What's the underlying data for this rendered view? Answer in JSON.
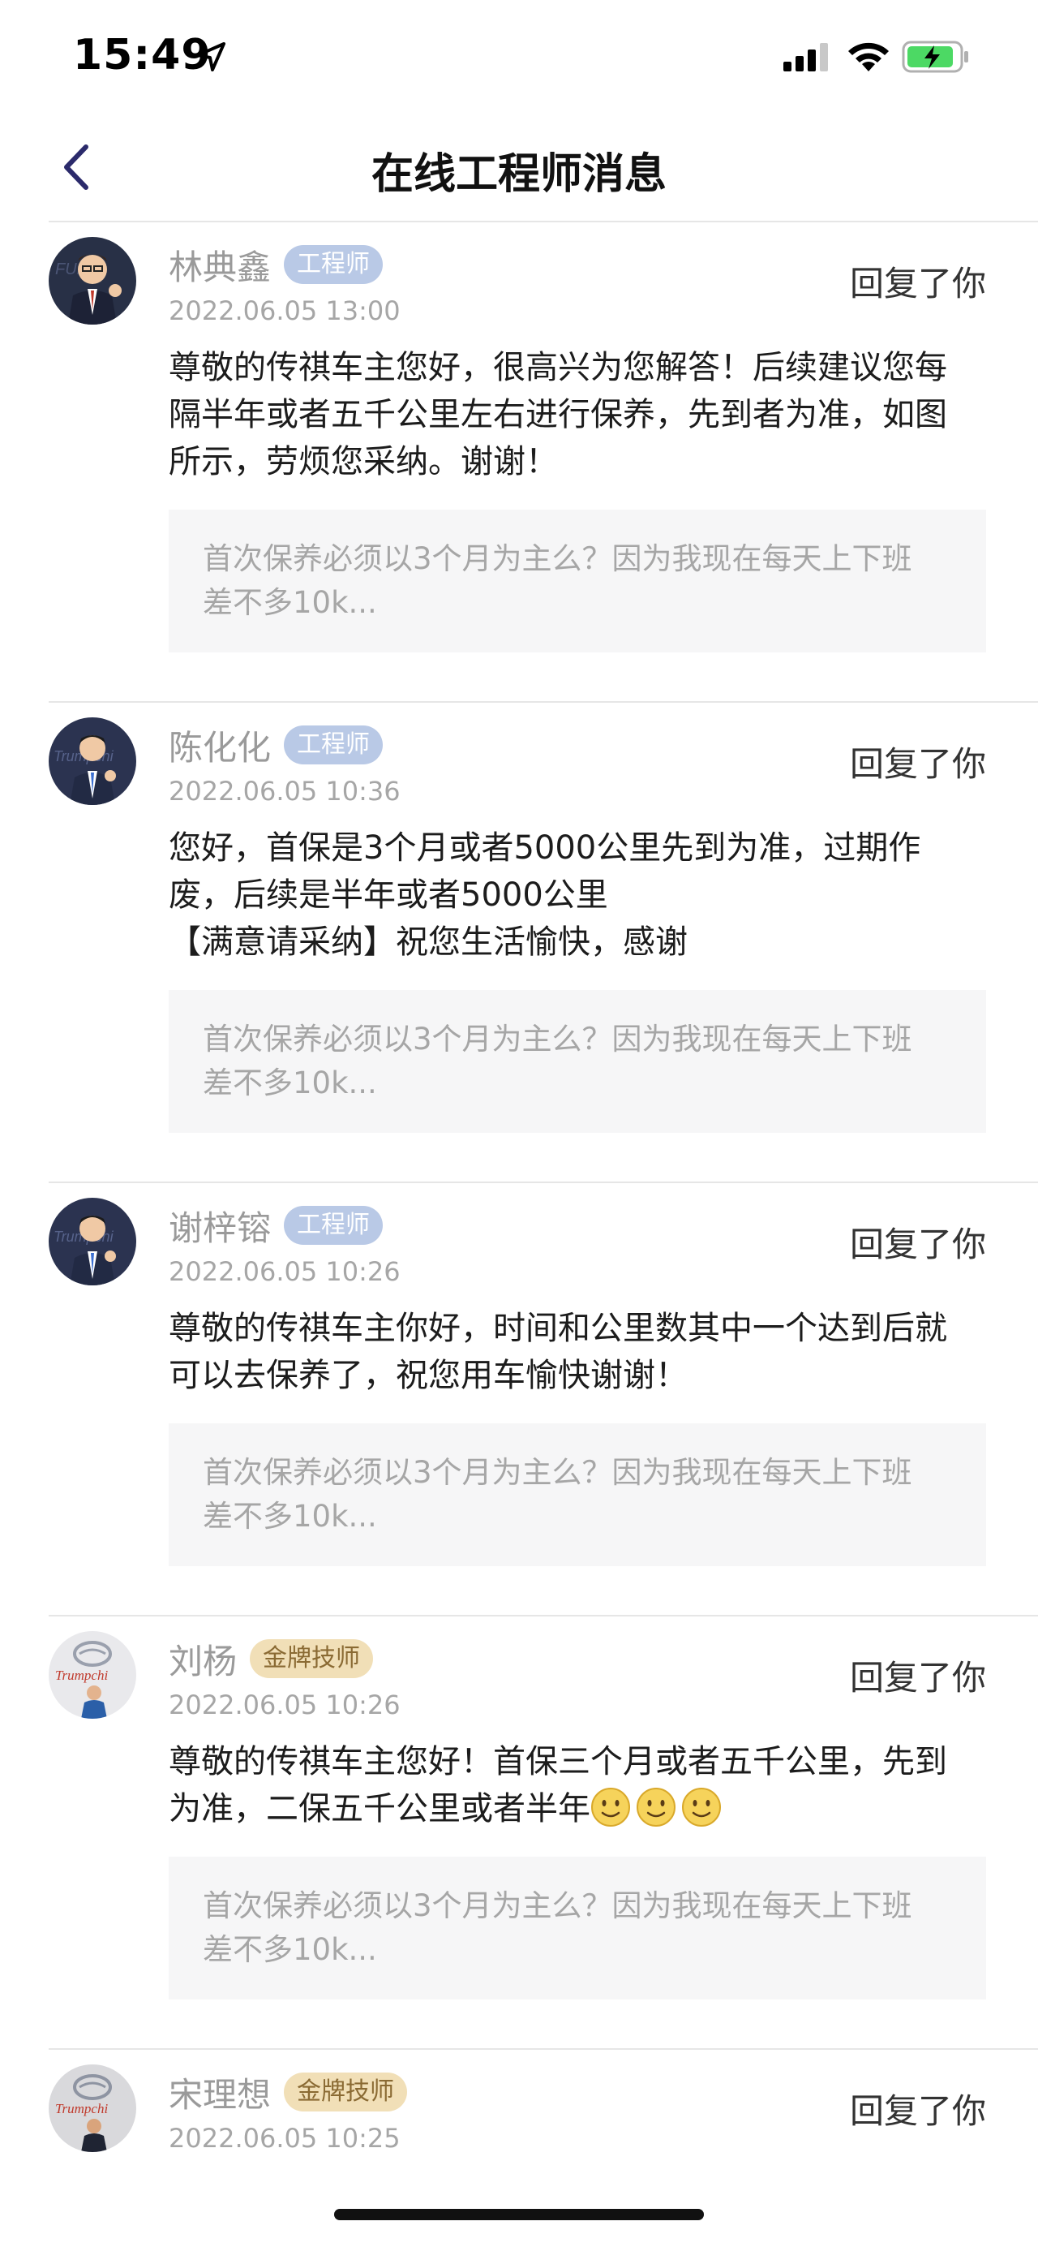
{
  "status_bar": {
    "time": "15:49"
  },
  "nav": {
    "title": "在线工程师消息"
  },
  "messages": [
    {
      "name": "林典鑫",
      "badge": "工程师",
      "time": "2022.06.05 13:00",
      "reply_label": "回复了你",
      "content": "尊敬的传祺车主您好，很高兴为您解答！后续建议您每\n隔半年或者五千公里左右进行保养，先到者为准，如图\n所示，劳烦您采纳。谢谢！",
      "quote": "首次保养必须以3个月为主么？因为我现在每天上下班\n差不多10k..."
    },
    {
      "name": "陈化化",
      "badge": "工程师",
      "time": "2022.06.05 10:36",
      "reply_label": "回复了你",
      "content": "您好，首保是3个月或者5000公里先到为准，过期作\n废，后续是半年或者5000公里\n【满意请采纳】祝您生活愉快，感谢",
      "quote": "首次保养必须以3个月为主么？因为我现在每天上下班\n差不多10k..."
    },
    {
      "name": "谢梓镕",
      "badge": "工程师",
      "time": "2022.06.05 10:26",
      "reply_label": "回复了你",
      "content": "尊敬的传祺车主你好，时间和公里数其中一个达到后就\n可以去保养了，祝您用车愉快谢谢！",
      "quote": "首次保养必须以3个月为主么？因为我现在每天上下班\n差不多10k..."
    },
    {
      "name": "刘杨",
      "badge": "金牌技师",
      "time": "2022.06.05 10:26",
      "reply_label": "回复了你",
      "content": "尊敬的传祺车主您好！首保三个月或者五千公里，先到\n为准，二保五千公里或者半年",
      "quote": "首次保养必须以3个月为主么？因为我现在每天上下班\n差不多10k..."
    },
    {
      "name": "宋理想",
      "badge": "金牌技师",
      "time": "2022.06.05 10:25",
      "reply_label": "回复了你"
    }
  ]
}
